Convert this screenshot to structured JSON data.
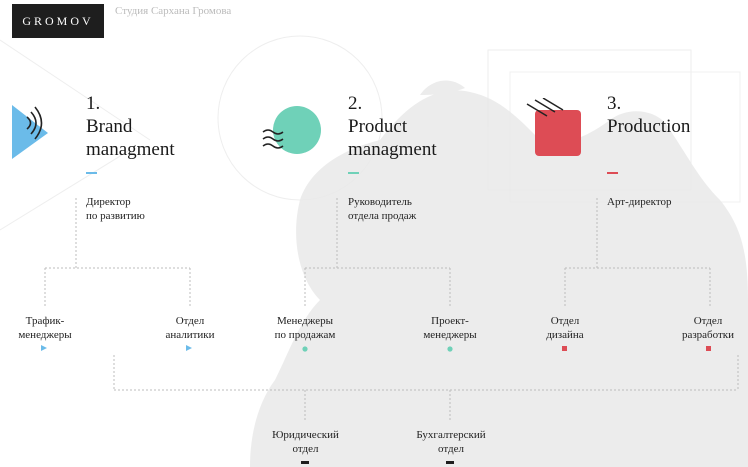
{
  "header": {
    "logo": "GROMOV",
    "subtitle": "Студия Сархана Громова"
  },
  "colors": {
    "blue": "#6bbbe9",
    "teal": "#6fd1b8",
    "red": "#dd4c55",
    "black": "#1e1e1e"
  },
  "sections": [
    {
      "number": "1.",
      "title_line1": "Brand",
      "title_line2": "managment",
      "role_line1": "Директор",
      "role_line2": "по развитию",
      "icon": "sound-play-icon"
    },
    {
      "number": "2.",
      "title_line1": "Product",
      "title_line2": "managment",
      "role_line1": "Руководитель",
      "role_line2": "отдела продаж",
      "icon": "waves-circle-icon"
    },
    {
      "number": "3.",
      "title_line1": "Production",
      "title_line2": "",
      "role_line1": "Арт-директор",
      "role_line2": "",
      "icon": "stripes-square-icon"
    }
  ],
  "departments": [
    {
      "line1": "Трафик-",
      "line2": "менеджеры",
      "marker": "triangle"
    },
    {
      "line1": "Отдел",
      "line2": "аналитики",
      "marker": "triangle"
    },
    {
      "line1": "Менеджеры",
      "line2": "по продажам",
      "marker": "dot"
    },
    {
      "line1": "Проект-",
      "line2": "менеджеры",
      "marker": "dot"
    },
    {
      "line1": "Отдел",
      "line2": "дизайна",
      "marker": "square"
    },
    {
      "line1": "Отдел",
      "line2": "разработки",
      "marker": "square"
    }
  ],
  "shared": [
    {
      "line1": "Юридический",
      "line2": "отдел",
      "marker": "bar"
    },
    {
      "line1": "Бухгалтерский",
      "line2": "отдел",
      "marker": "bar"
    }
  ]
}
